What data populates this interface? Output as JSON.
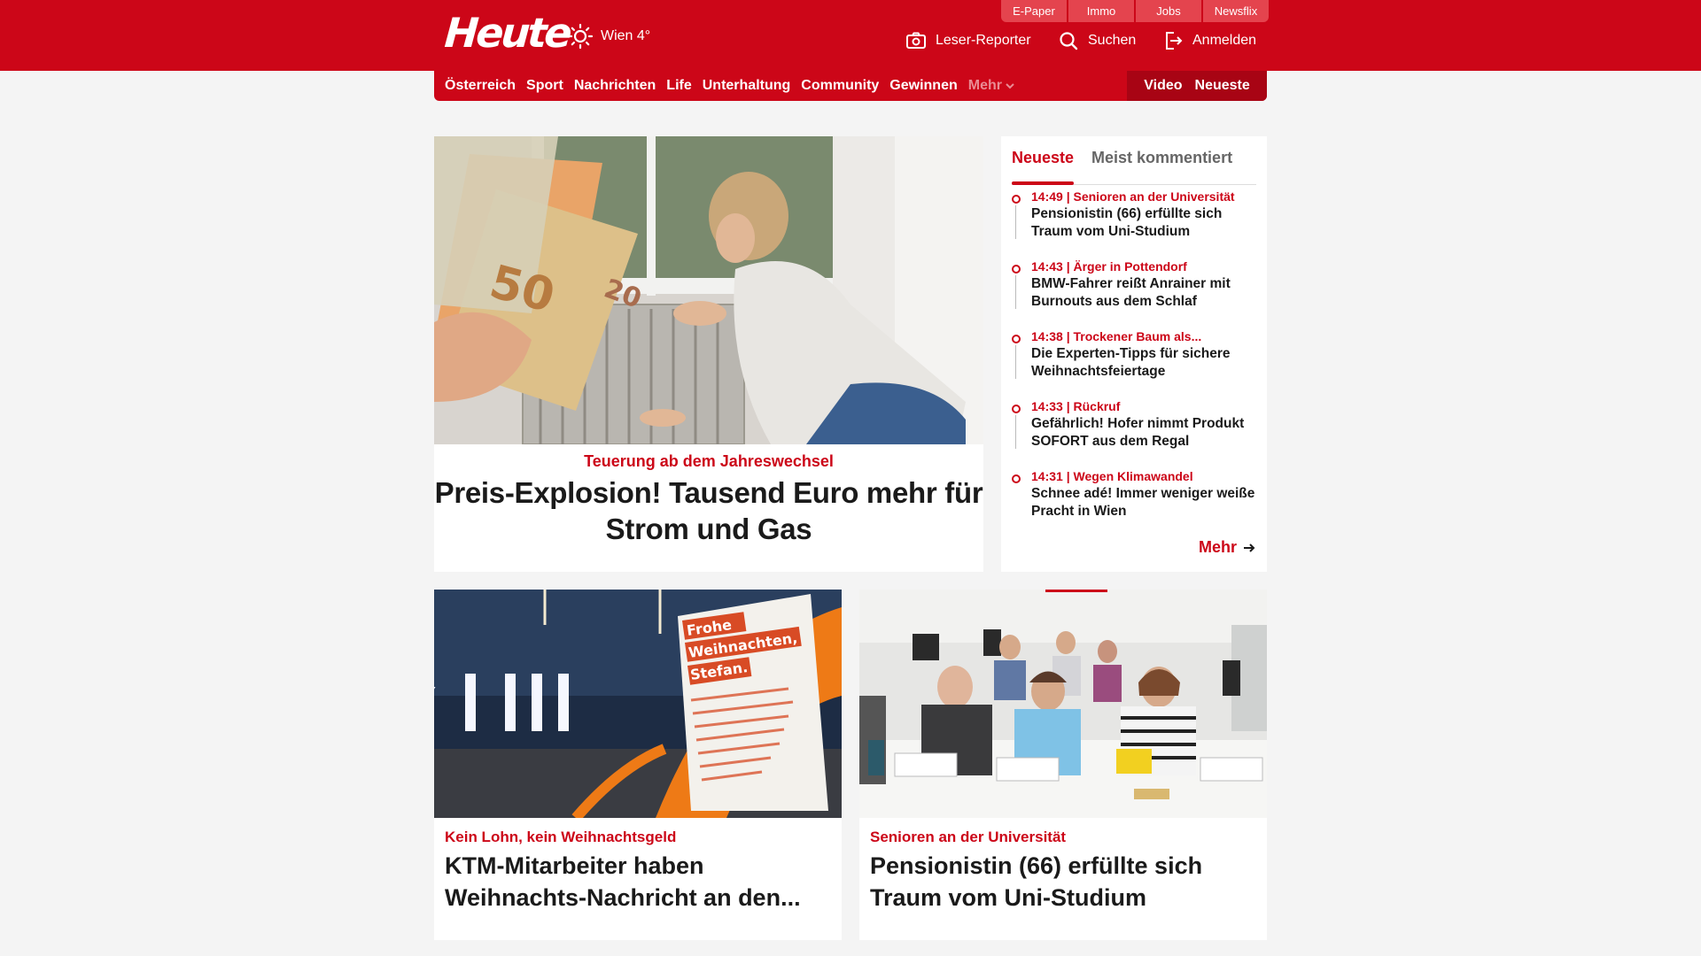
{
  "header": {
    "logo": "Heute",
    "weather": "Wien 4°",
    "top_links": [
      "E-Paper",
      "Immo",
      "Jobs",
      "Newsflix"
    ],
    "actions": {
      "reporter": "Leser-Reporter",
      "search": "Suchen",
      "login": "Anmelden"
    }
  },
  "nav": {
    "items": [
      "Österreich",
      "Sport",
      "Nachrichten",
      "Life",
      "Unterhaltung",
      "Community",
      "Gewinnen"
    ],
    "more": "Mehr",
    "video": "Video",
    "newest": "Neueste"
  },
  "hero": {
    "kicker": "Teuerung ab dem Jahreswechsel",
    "title": "Preis-Explosion! Tausend Euro mehr für Strom und Gas"
  },
  "sidebar": {
    "tabs": [
      "Neueste",
      "Meist kommentiert"
    ],
    "items": [
      {
        "meta": "14:49 | Senioren an der Universität",
        "title": "Pensionistin (66) erfüllte sich Traum vom Uni-Studium"
      },
      {
        "meta": "14:43 | Ärger in Pottendorf",
        "title": "BMW-Fahrer reißt Anrainer mit Burnouts aus dem Schlaf"
      },
      {
        "meta": "14:38 | Trockener Baum als...",
        "title": "Die Experten-Tipps für sichere Weihnachtsfeiertage"
      },
      {
        "meta": "14:33 | Rückruf",
        "title": "Gefährlich! Hofer nimmt Produkt SOFORT aus dem Regal"
      },
      {
        "meta": "14:31 | Wegen Klimawandel",
        "title": "Schnee adé! Immer weniger weiße Pracht in Wien"
      }
    ],
    "more": "Mehr"
  },
  "cards": [
    {
      "kicker": "Kein Lohn, kein Weihnachtsgeld",
      "title": "KTM-Mitarbeiter haben Weihnachts-Nachricht an den...",
      "sign": {
        "line1": "Frohe",
        "line2": "Weihnachten,",
        "line3": "Stefan."
      }
    },
    {
      "kicker": "Senioren an der Universität",
      "title": "Pensionistin (66) erfüllte sich Traum vom Uni-Studium"
    }
  ],
  "colors": {
    "brand": "#cc0618",
    "brand_dark": "#a80414",
    "text": "#1a1a1a"
  },
  "icons": [
    "sun-icon",
    "camera-icon",
    "search-icon",
    "login-icon",
    "chevron-down-icon",
    "arrow-right-icon"
  ]
}
